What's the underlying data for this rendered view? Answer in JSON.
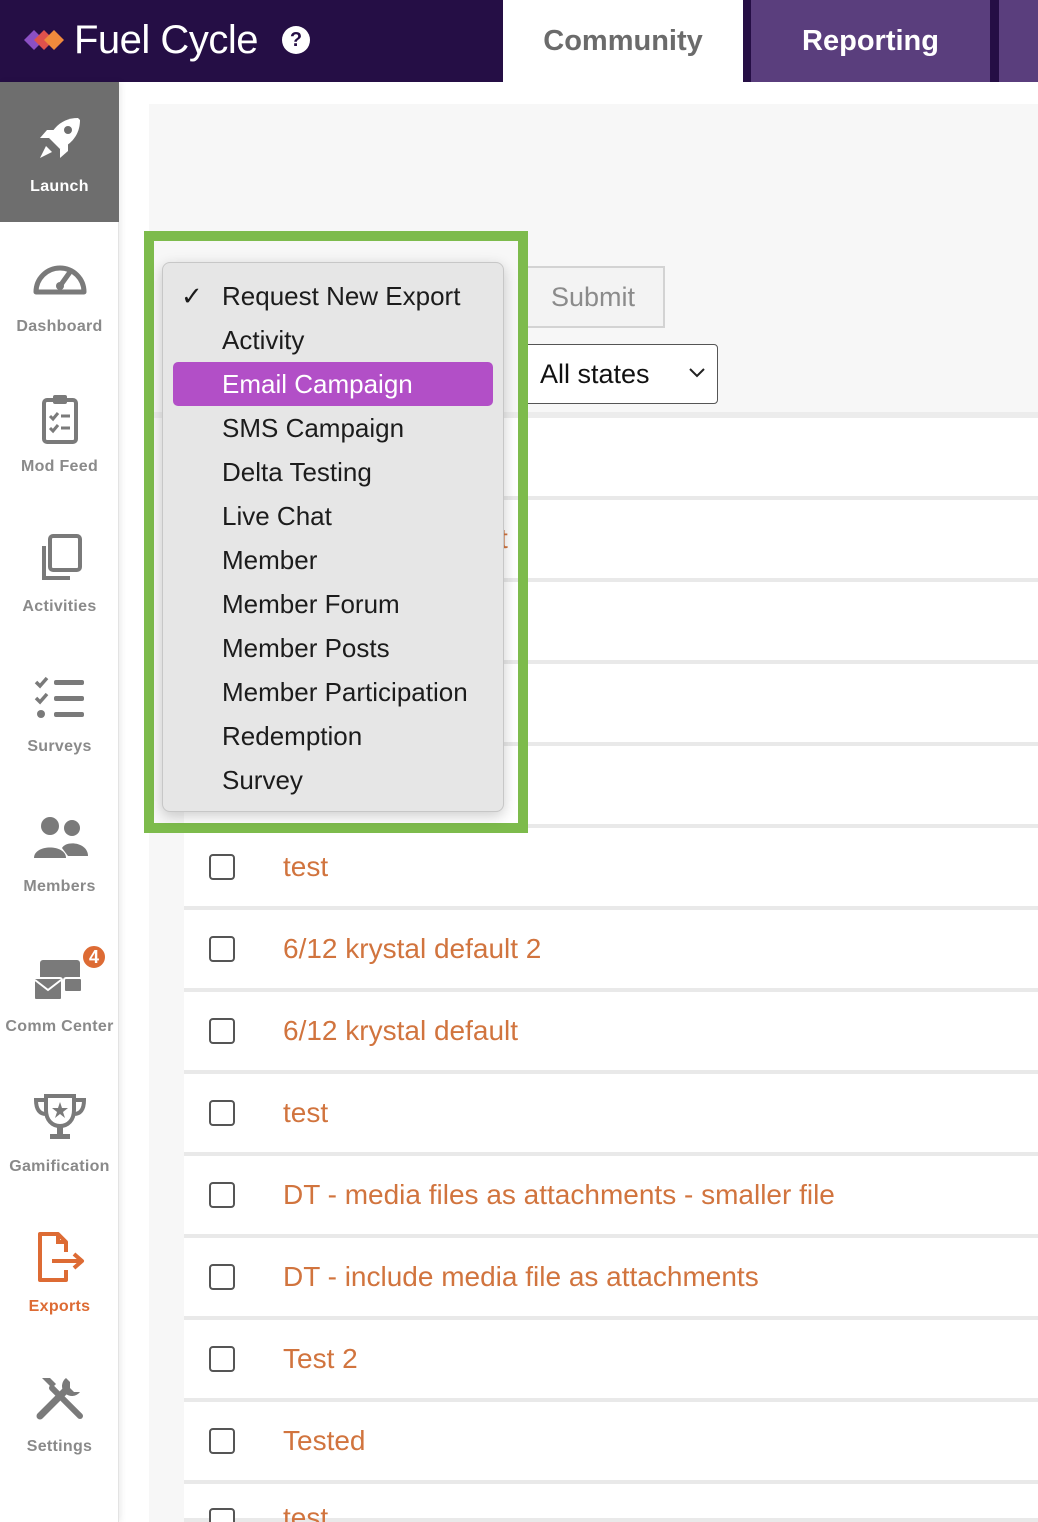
{
  "header": {
    "brand": "Fuel Cycle",
    "help": "?",
    "tabs": [
      {
        "label": "Community",
        "active": true
      },
      {
        "label": "Reporting",
        "active": false
      }
    ],
    "colors": {
      "bar": "#250e45",
      "reporting_tab": "#5a3e7d"
    }
  },
  "sidebar": {
    "items": [
      {
        "label": "Launch",
        "icon": "rocket-icon"
      },
      {
        "label": "Dashboard",
        "icon": "gauge-icon"
      },
      {
        "label": "Mod Feed",
        "icon": "clipboard-icon"
      },
      {
        "label": "Activities",
        "icon": "copy-icon"
      },
      {
        "label": "Surveys",
        "icon": "checklist-icon"
      },
      {
        "label": "Members",
        "icon": "users-icon"
      },
      {
        "label": "Comm Center",
        "icon": "mail-icon",
        "badge": "4"
      },
      {
        "label": "Gamification",
        "icon": "trophy-icon"
      },
      {
        "label": "Exports",
        "icon": "export-icon"
      },
      {
        "label": "Settings",
        "icon": "tools-icon"
      }
    ],
    "colors": {
      "exports_active": "#dd6b34",
      "launch_bg": "#6e6e6e"
    }
  },
  "form": {
    "submit_label": "Submit",
    "state_select": "All states"
  },
  "export_type_menu": {
    "items": [
      {
        "label": "Request New Export",
        "checked": true
      },
      {
        "label": "Activity"
      },
      {
        "label": "Email Campaign",
        "selected": true
      },
      {
        "label": "SMS Campaign"
      },
      {
        "label": "Delta Testing"
      },
      {
        "label": "Live Chat"
      },
      {
        "label": "Member"
      },
      {
        "label": "Member Forum"
      },
      {
        "label": "Member Posts"
      },
      {
        "label": "Member Participation"
      },
      {
        "label": "Redemption"
      },
      {
        "label": "Survey"
      }
    ],
    "check_mark": "✓",
    "colors": {
      "selected": "#b24fc7",
      "highlight_border": "#7dbb4c"
    }
  },
  "table": {
    "partial_text": "t",
    "rows": [
      {
        "name": "test"
      },
      {
        "name": "6/12 krystal default 2"
      },
      {
        "name": "6/12 krystal default"
      },
      {
        "name": "test"
      },
      {
        "name": "DT - media files as attachments - smaller file"
      },
      {
        "name": "DT - include media file as attachments"
      },
      {
        "name": "Test 2"
      },
      {
        "name": "Tested"
      },
      {
        "name": "test"
      }
    ],
    "colors": {
      "link": "#d1743e"
    }
  }
}
